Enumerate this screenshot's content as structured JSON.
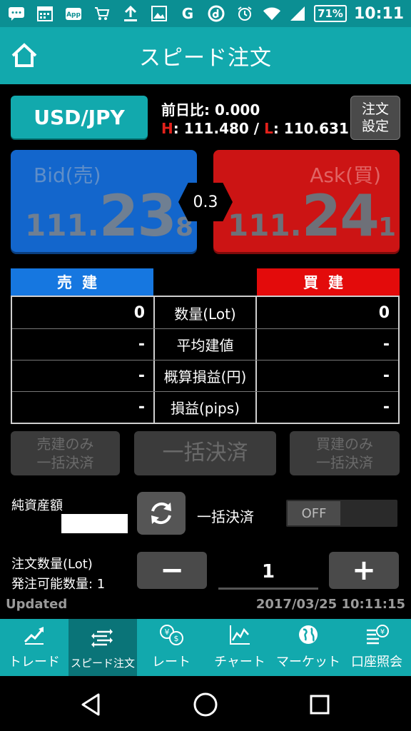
{
  "status_bar": {
    "icons": [
      "message-icon",
      "calendar-icon",
      "app-icon",
      "cart-icon",
      "upload-icon",
      "image-icon",
      "g-icon",
      "d-icon",
      "alarm-icon",
      "wifi-icon",
      "signal-icon"
    ],
    "battery": "71%",
    "time": "10:11"
  },
  "header": {
    "title": "スピード注文"
  },
  "pair": {
    "label": "USD/JPY"
  },
  "quote_info": {
    "prev_label": "前日比:",
    "prev_value": "0.000",
    "high_label": "H",
    "high_value": "111.480",
    "sep": "/",
    "low_label": "L",
    "low_value": "110.631"
  },
  "order_settings": {
    "line1": "注文",
    "line2": "設定"
  },
  "bid": {
    "label": "Bid(売)",
    "p1": "111.",
    "p2": "23",
    "p3": "8",
    "color": "#1366cc"
  },
  "ask": {
    "label": "Ask(買)",
    "p1": "111.",
    "p2": "24",
    "p3": "1",
    "color": "#cc1414"
  },
  "spread": "0.3",
  "positions": {
    "sell_header": "売建",
    "buy_header": "買建",
    "rows": [
      {
        "label": "数量(Lot)",
        "sell": "0",
        "buy": "0"
      },
      {
        "label": "平均建値",
        "sell": "-",
        "buy": "-"
      },
      {
        "label": "概算損益(円)",
        "sell": "-",
        "buy": "-"
      },
      {
        "label": "損益(pips)",
        "sell": "-",
        "buy": "-"
      }
    ]
  },
  "settle": {
    "sell_only_1": "売建のみ",
    "sell_only_2": "一括決済",
    "all": "一括決済",
    "buy_only_1": "買建のみ",
    "buy_only_2": "一括決済"
  },
  "net_assets": {
    "label": "純資産額",
    "value": ""
  },
  "bulk_settle": {
    "label": "一括決済",
    "toggle": "OFF"
  },
  "order_qty": {
    "label": "注文数量(Lot)",
    "available": "発注可能数量: 1",
    "minus": "−",
    "plus": "+",
    "value": "1"
  },
  "updated": {
    "label": "Updated",
    "time": "2017/03/25 10:11:15"
  },
  "tabs": [
    {
      "label": "トレード",
      "icon": "trade-chart-icon"
    },
    {
      "label": "スピード注文",
      "icon": "speed-order-icon",
      "active": true
    },
    {
      "label": "レート",
      "icon": "rate-icon"
    },
    {
      "label": "チャート",
      "icon": "chart-icon"
    },
    {
      "label": "マーケット",
      "icon": "globe-icon"
    },
    {
      "label": "口座照会",
      "icon": "account-icon"
    }
  ]
}
